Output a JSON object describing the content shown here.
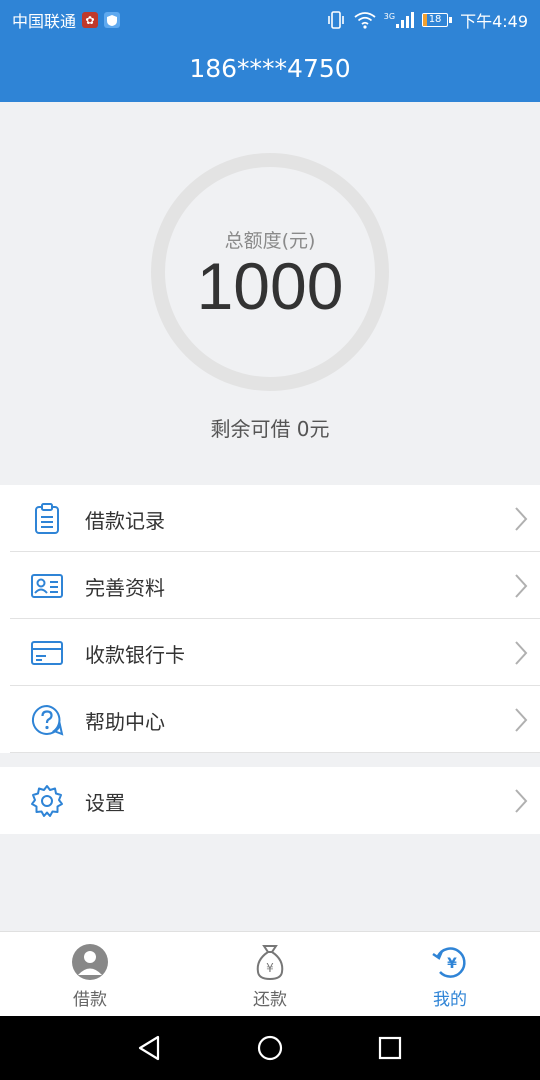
{
  "status_bar": {
    "carrier": "中国联通",
    "network_type": "3G",
    "battery_level": "18",
    "time": "下午4:49"
  },
  "header": {
    "title": "186****4750"
  },
  "credit": {
    "label": "总额度(元)",
    "amount": "1000",
    "remaining": "剩余可借 0元"
  },
  "menu": {
    "items": [
      {
        "label": "借款记录",
        "icon": "clipboard-icon"
      },
      {
        "label": "完善资料",
        "icon": "id-card-icon"
      },
      {
        "label": "收款银行卡",
        "icon": "bank-card-icon"
      },
      {
        "label": "帮助中心",
        "icon": "help-icon"
      }
    ],
    "settings": {
      "label": "设置",
      "icon": "gear-icon"
    }
  },
  "tabbar": {
    "tabs": [
      {
        "label": "借款",
        "icon": "avatar-icon"
      },
      {
        "label": "还款",
        "icon": "money-bag-icon"
      },
      {
        "label": "我的",
        "icon": "yuan-refresh-icon"
      }
    ],
    "active_index": 2
  },
  "colors": {
    "primary": "#2f84d6",
    "page_bg": "#f0f1f3",
    "text": "#333333",
    "muted": "#8a8a8a",
    "gauge_track": "#e3e3e3"
  }
}
